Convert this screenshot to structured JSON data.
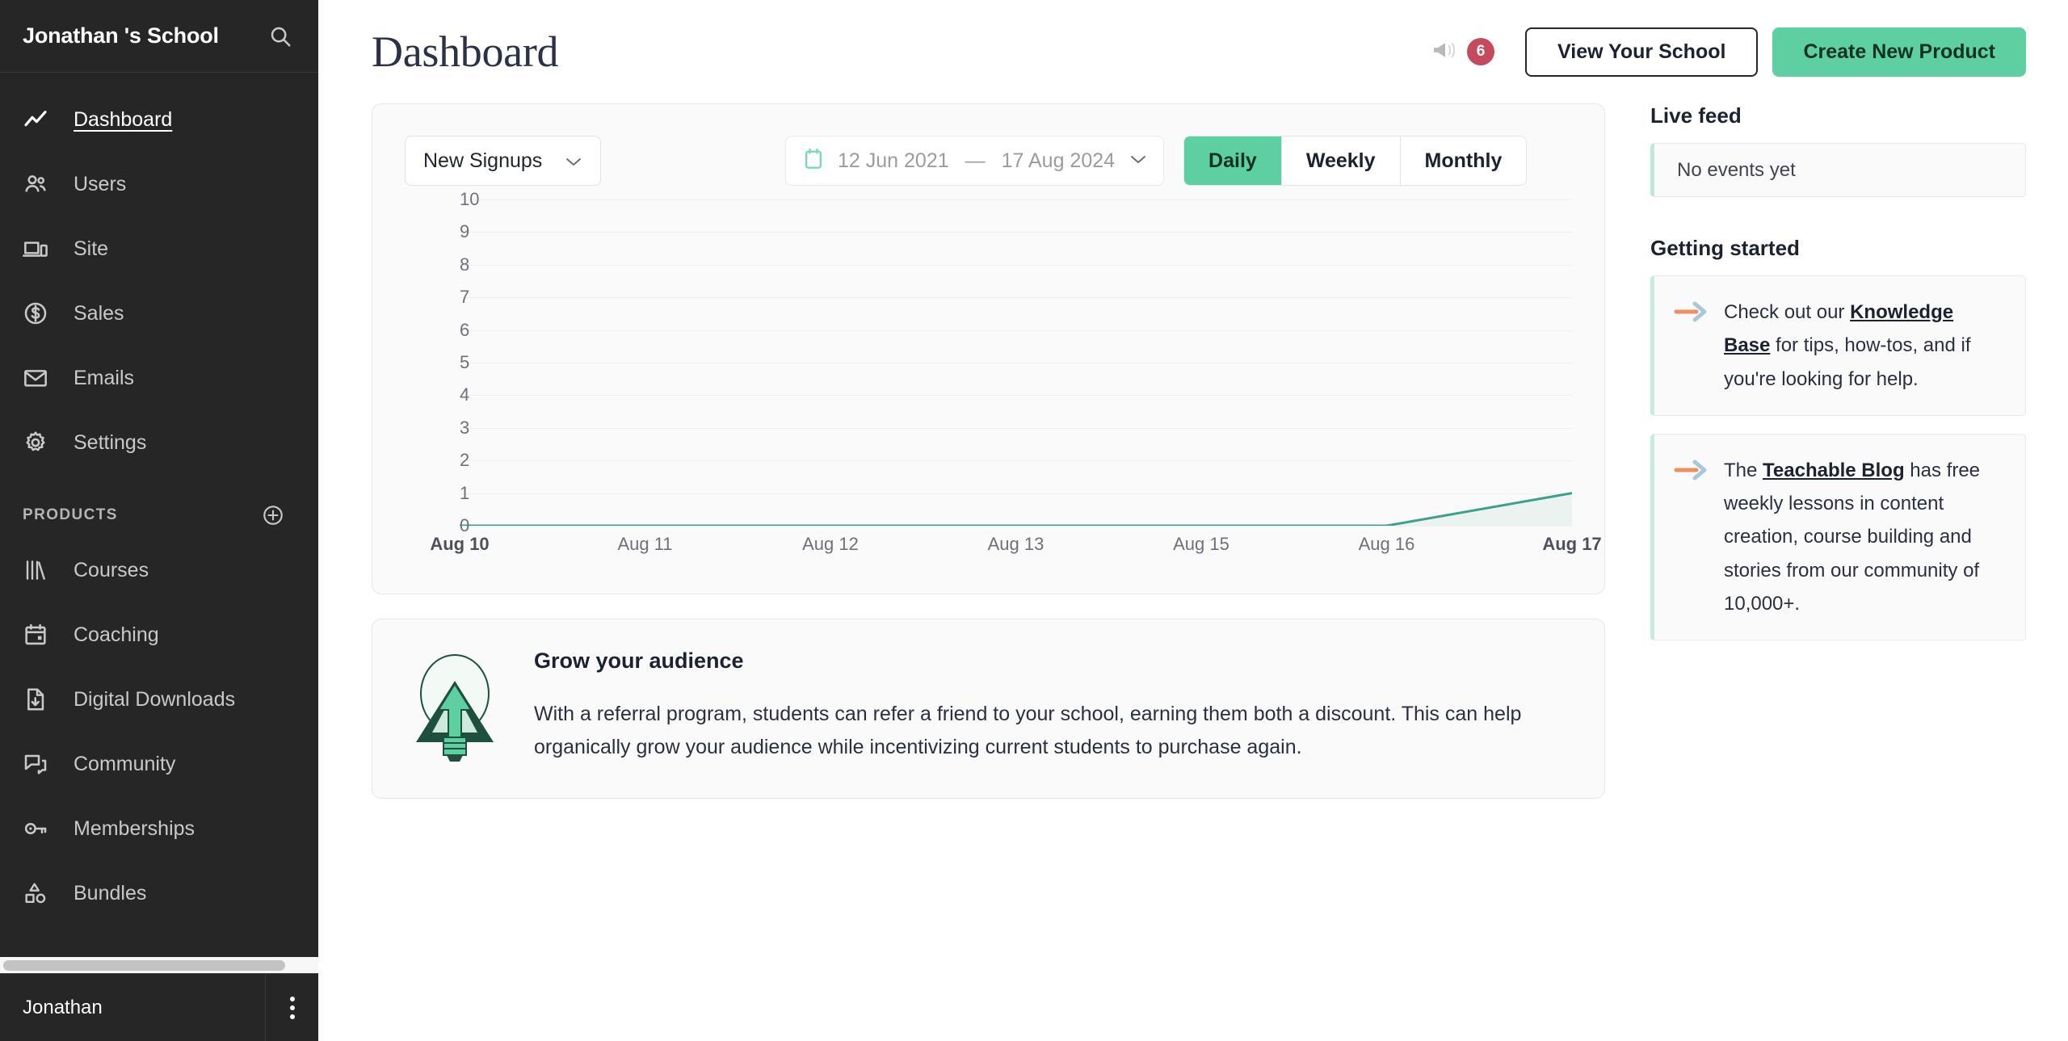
{
  "sidebar": {
    "school_name": "Jonathan 's School",
    "search_icon": "search-icon",
    "nav": [
      {
        "label": "Dashboard",
        "icon": "trend-line-icon",
        "active": true
      },
      {
        "label": "Users",
        "icon": "users-icon",
        "active": false
      },
      {
        "label": "Site",
        "icon": "devices-icon",
        "active": false
      },
      {
        "label": "Sales",
        "icon": "dollar-circle-icon",
        "active": false
      },
      {
        "label": "Emails",
        "icon": "envelope-icon",
        "active": false
      },
      {
        "label": "Settings",
        "icon": "gear-icon",
        "active": false
      }
    ],
    "products_section_title": "PRODUCTS",
    "products_add_icon": "plus-circle-icon",
    "products": [
      {
        "label": "Courses",
        "icon": "books-icon"
      },
      {
        "label": "Coaching",
        "icon": "calendar-icon"
      },
      {
        "label": "Digital Downloads",
        "icon": "file-download-icon"
      },
      {
        "label": "Community",
        "icon": "chat-bubbles-icon"
      },
      {
        "label": "Memberships",
        "icon": "key-icon"
      },
      {
        "label": "Bundles",
        "icon": "shapes-icon"
      }
    ],
    "user_name": "Jonathan",
    "user_menu_icon": "kebab-menu-icon"
  },
  "header": {
    "title": "Dashboard",
    "announcement_icon": "megaphone-icon",
    "announcement_count": "6",
    "view_school_label": "View Your School",
    "create_product_label": "Create New Product"
  },
  "chart_panel": {
    "metric_select_value": "New Signups",
    "metric_chevron_icon": "chevron-down-icon",
    "date_calendar_icon": "calendar-icon",
    "date_start": "12 Jun 2021",
    "date_separator": "—",
    "date_end": "17 Aug 2024",
    "date_chevron_icon": "chevron-down-icon",
    "granularity": [
      {
        "label": "Daily",
        "selected": true
      },
      {
        "label": "Weekly",
        "selected": false
      },
      {
        "label": "Monthly",
        "selected": false
      }
    ]
  },
  "chart_data": {
    "type": "area",
    "title": "New Signups",
    "xlabel": "",
    "ylabel": "",
    "categories": [
      "Aug 10",
      "Aug 11",
      "Aug 12",
      "Aug 13",
      "Aug 15",
      "Aug 16",
      "Aug 17"
    ],
    "values": [
      0,
      0,
      0,
      0,
      0,
      0,
      1
    ],
    "yticks": [
      0,
      1,
      2,
      3,
      4,
      5,
      6,
      7,
      8,
      9,
      10
    ],
    "ylim": [
      0,
      10
    ],
    "grid": true,
    "legend": "none",
    "line_color": "#3ea08b",
    "fill_color": "#eaf3f0",
    "bold_ticks": [
      "Aug 10",
      "Aug 17"
    ]
  },
  "right_column": {
    "live_feed_title": "Live feed",
    "live_feed_empty": "No events yet",
    "getting_started_title": "Getting started",
    "cards": [
      {
        "icon": "arrow-right-icon",
        "prefix": "Check out our ",
        "link": "Knowledge Base",
        "suffix": " for tips, how-tos, and if you're looking for help."
      },
      {
        "icon": "arrow-right-icon",
        "prefix": "The ",
        "link": "Teachable Blog",
        "suffix": " has free weekly lessons in content creation, course building and stories from our community of 10,000+."
      }
    ]
  },
  "promo": {
    "icon": "lightbulb-rocket-icon",
    "heading": "Grow your audience",
    "body": "With a referral program, students can refer a friend to your school, earning them both a discount. This can help organically grow your audience while incentivizing current students to purchase again."
  },
  "colors": {
    "accent_green": "#5ecfa0",
    "line_green": "#3ea08b",
    "badge_red": "#c44a5c",
    "sidebar_bg": "#262626",
    "arrow_orange": "#ef8e5f",
    "arrow_blue": "#a9c8da"
  }
}
